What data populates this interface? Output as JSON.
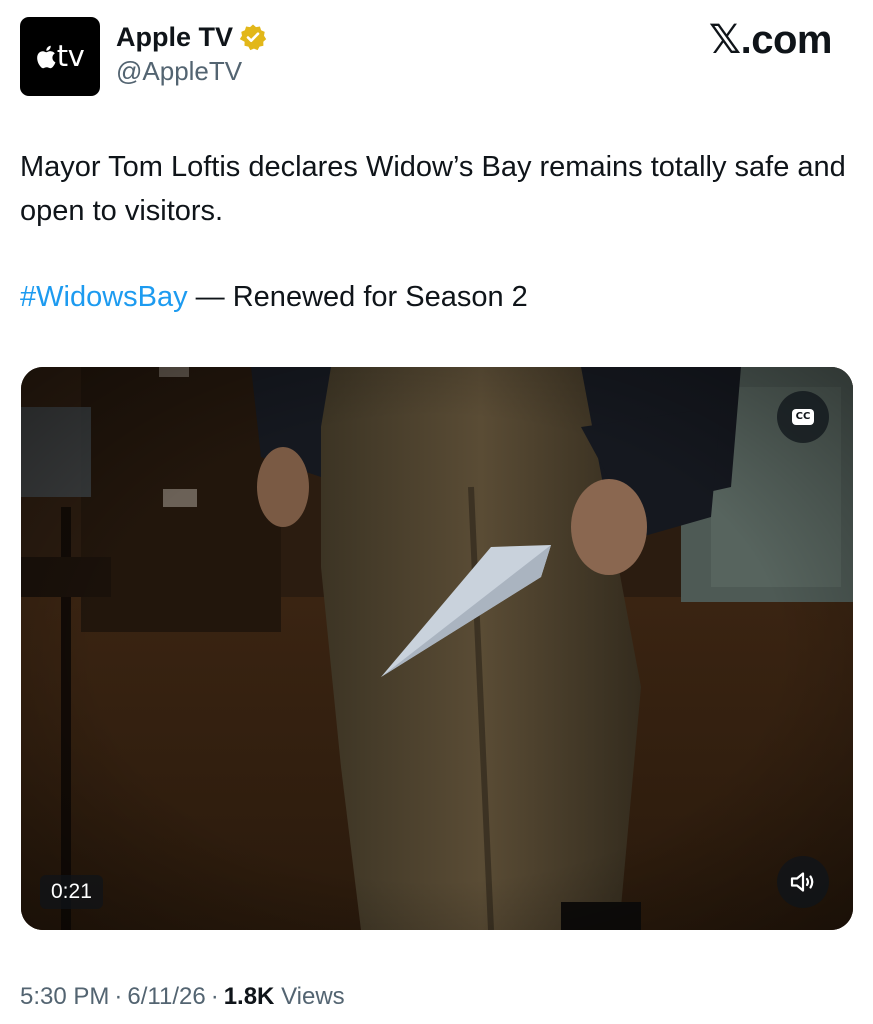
{
  "account": {
    "avatar_text": "tv",
    "display_name": "Apple TV",
    "handle": "@AppleTV",
    "verified": true,
    "verified_badge_color": "#e2b719"
  },
  "site_label": "𝕏.com",
  "tweet": {
    "text": "Mayor Tom Loftis declares Widow’s Bay remains totally safe and open to visitors.",
    "hashtag": "#WidowsBay",
    "hashtag_color": "#1d9bf0",
    "suffix": " — Renewed for Season 2"
  },
  "media": {
    "duration": "0:21",
    "cc_icon": "cc-icon",
    "mute_icon": "speaker-muted-icon"
  },
  "meta": {
    "time": "5:30 PM",
    "separator": "·",
    "date": "6/11/26",
    "views_count": "1.8K",
    "views_label": "Views"
  }
}
